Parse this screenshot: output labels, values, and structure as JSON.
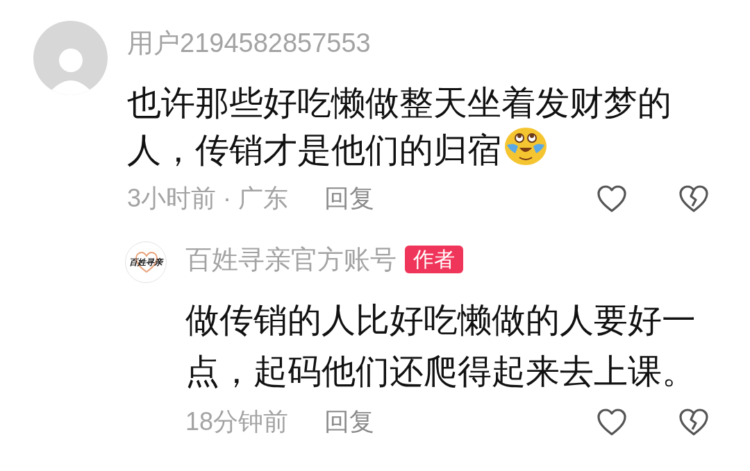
{
  "comment": {
    "username": "用户2194582857553",
    "text": "也许那些好吃懒做整天坐着发财梦的人，传销才是他们的归宿",
    "ends_with_emoji": true,
    "time_location": "3小时前 · 广东",
    "reply_label": "回复",
    "replies": [
      {
        "username": "百姓寻亲官方账号",
        "logo_text": "百姓寻亲",
        "badge": "作者",
        "text": "做传销的人比好吃懒做的人要好一点，起码他们还爬得起来去上课。",
        "ends_with_emoji": false,
        "time_location": "18分钟前",
        "reply_label": "回复"
      }
    ]
  }
}
